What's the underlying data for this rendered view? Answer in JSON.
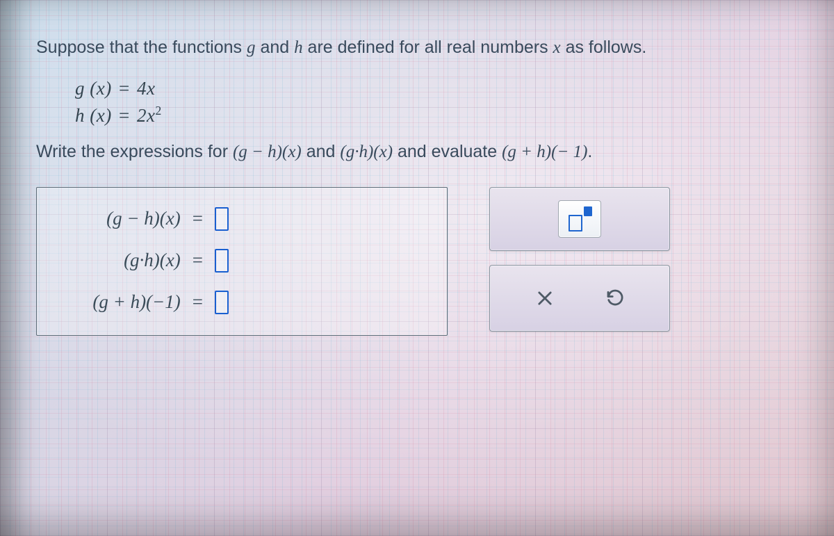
{
  "intro": {
    "pre": "Suppose that the functions ",
    "g": "g",
    "mid1": " and ",
    "h": "h",
    "mid2": " are defined for all real numbers ",
    "x": "x",
    "post": " as follows."
  },
  "defs": {
    "g_lhs": "g (x)",
    "g_eq": "=",
    "g_rhs": "4x",
    "h_lhs": "h (x)",
    "h_eq": "=",
    "h_rhs_base": "2x",
    "h_rhs_exp": "2"
  },
  "task": {
    "pre": "Write the expressions for ",
    "e1": "(g − h)(x)",
    "mid1": " and ",
    "e2": "(g·h)(x)",
    "mid2": " and evaluate ",
    "e3": "(g + h)(− 1)",
    "post": "."
  },
  "answers": {
    "r1_lhs": "(g − h)(x)",
    "r2_lhs": "(g·h)(x)",
    "r3_lhs": "(g + h)(−1)",
    "eq": "="
  },
  "tools": {
    "exponent_name": "exponent-template",
    "clear_name": "clear",
    "reset_name": "reset"
  }
}
